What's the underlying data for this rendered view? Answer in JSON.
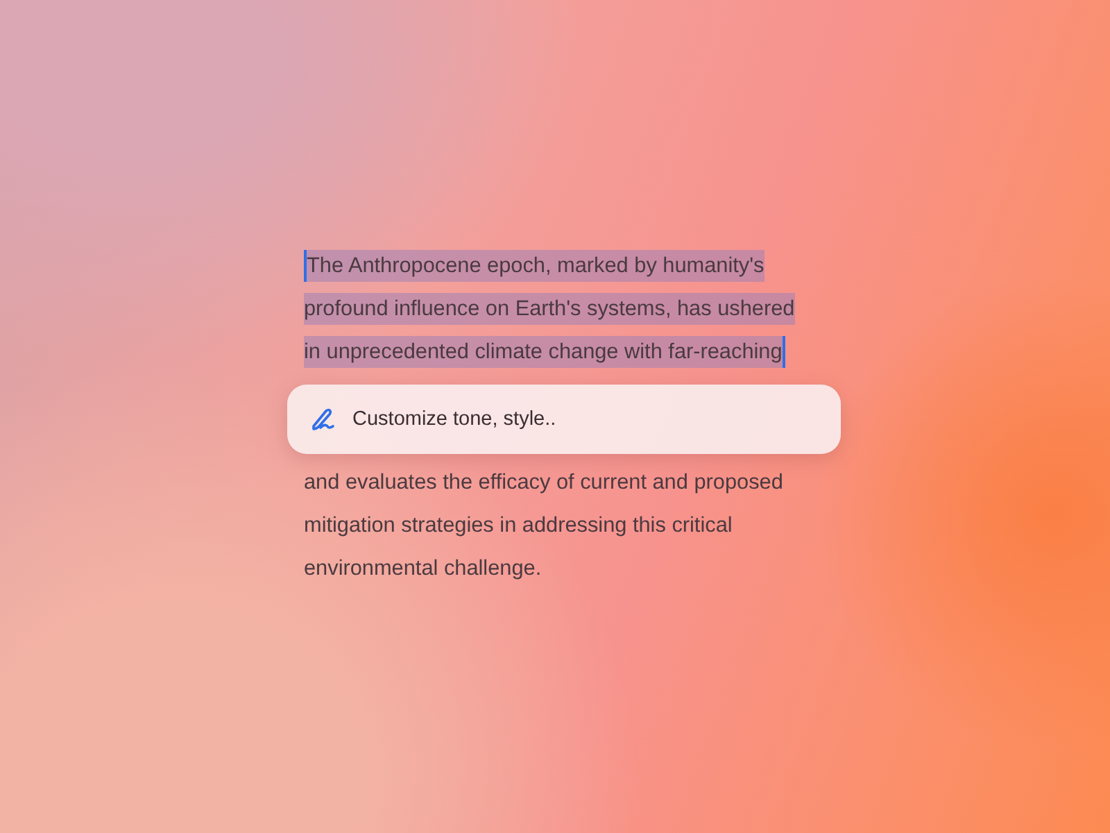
{
  "paragraph_lines": [
    {
      "text": "The Anthropocene epoch, marked by humanity's",
      "selected": true
    },
    {
      "text": "profound influence on Earth's systems, has ushered",
      "selected": true
    },
    {
      "text": "in unprecedented climate change with far-reaching",
      "selected": true
    },
    {
      "text": "and evaluates the efficacy of current and proposed",
      "selected": false
    },
    {
      "text": "mitigation strategies in addressing this critical",
      "selected": false
    },
    {
      "text": "environmental challenge.",
      "selected": false
    }
  ],
  "prompt_field": {
    "placeholder": "Customize tone, style.."
  }
}
